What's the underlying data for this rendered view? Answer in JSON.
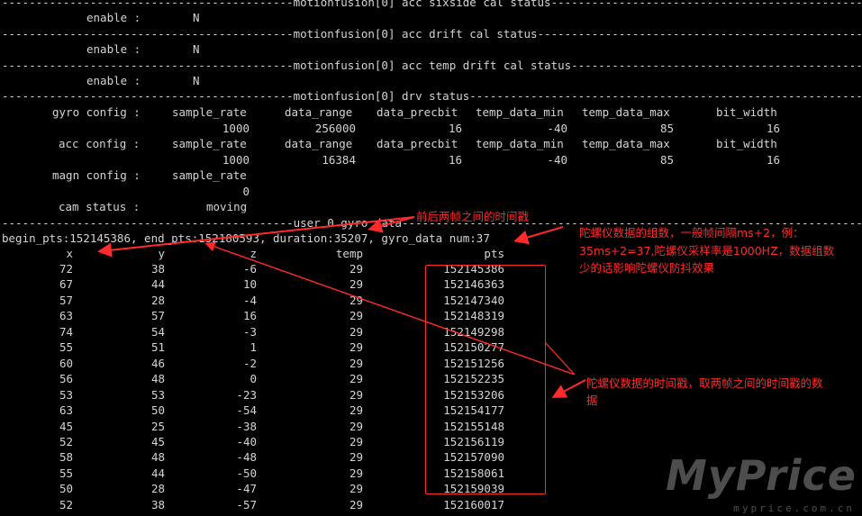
{
  "sections": [
    {
      "title": "motionfusion[0] acc sixside cal status",
      "line": "-------------------------------------------motionfusion[0] acc sixside cal status----------------------------------------------",
      "enable_label": "enable :",
      "enable_value": "N"
    },
    {
      "title": "motionfusion[0] acc drift cal status",
      "line": "-------------------------------------------motionfusion[0] acc drift cal status------------------------------------------------",
      "enable_label": "enable :",
      "enable_value": "N"
    },
    {
      "title": "motionfusion[0] acc temp drift cal status",
      "line": "-------------------------------------------motionfusion[0] acc temp drift cal status-------------------------------------------",
      "enable_label": "enable :",
      "enable_value": "N"
    }
  ],
  "drv": {
    "line": "-------------------------------------------motionfusion[0] drv status-----------------------------------------------------------",
    "gyro": {
      "label": "gyro config :",
      "headers": [
        "sample_rate",
        "data_range",
        "data_precbit",
        "temp_data_min",
        "temp_data_max",
        "bit_width"
      ],
      "values": [
        "1000",
        "256000",
        "16",
        "-40",
        "85",
        "16"
      ]
    },
    "acc": {
      "label": "acc config :",
      "headers": [
        "sample_rate",
        "data_range",
        "data_precbit",
        "temp_data_min",
        "temp_data_max",
        "bit_width"
      ],
      "values": [
        "1000",
        "16384",
        "16",
        "-40",
        "85",
        "16"
      ]
    },
    "magn": {
      "label": "magn config :",
      "header": "sample_rate",
      "value": "0"
    },
    "cam": {
      "label": "cam status :",
      "value": "moving"
    }
  },
  "user": {
    "line": "-------------------------------------------user 0 gyro_data----------------------------------------------------------------------",
    "summary": "begin_pts:152145386, end_pts:152180593, duration:35207, gyro_data num:37",
    "columns": [
      "x",
      "y",
      "z",
      "temp",
      "pts"
    ],
    "rows": [
      [
        "72",
        "38",
        "-6",
        "29",
        "152145386"
      ],
      [
        "67",
        "44",
        "10",
        "29",
        "152146363"
      ],
      [
        "57",
        "28",
        "-4",
        "29",
        "152147340"
      ],
      [
        "63",
        "57",
        "16",
        "29",
        "152148319"
      ],
      [
        "74",
        "54",
        "-3",
        "29",
        "152149298"
      ],
      [
        "55",
        "51",
        "1",
        "29",
        "152150277"
      ],
      [
        "60",
        "46",
        "-2",
        "29",
        "152151256"
      ],
      [
        "56",
        "48",
        "0",
        "29",
        "152152235"
      ],
      [
        "53",
        "53",
        "-23",
        "29",
        "152153206"
      ],
      [
        "63",
        "50",
        "-54",
        "29",
        "152154177"
      ],
      [
        "45",
        "25",
        "-38",
        "29",
        "152155148"
      ],
      [
        "52",
        "45",
        "-40",
        "29",
        "152156119"
      ],
      [
        "58",
        "48",
        "-48",
        "29",
        "152157090"
      ],
      [
        "55",
        "44",
        "-50",
        "29",
        "152158061"
      ],
      [
        "50",
        "28",
        "-47",
        "29",
        "152159039"
      ],
      [
        "52",
        "38",
        "-57",
        "29",
        "152160017"
      ]
    ]
  },
  "annotations": {
    "frame_time": "前后两帧之间的时间戳",
    "gyro_count_1": "陀螺仪数据的组数，一般帧间隔ms+2，例：",
    "gyro_count_2": "35ms+2=37,陀螺仪采样率是1000HZ，数据组数",
    "gyro_count_3": "少的话影响陀螺仪防抖效果",
    "gyro_time_1": "陀螺仪数据的时间戳，取两帧之间的时间戳的数",
    "gyro_time_2": "据",
    "color": "#ff2a2a"
  },
  "watermark": {
    "brand": "MyPrice",
    "url": "myprice.com.cn"
  }
}
